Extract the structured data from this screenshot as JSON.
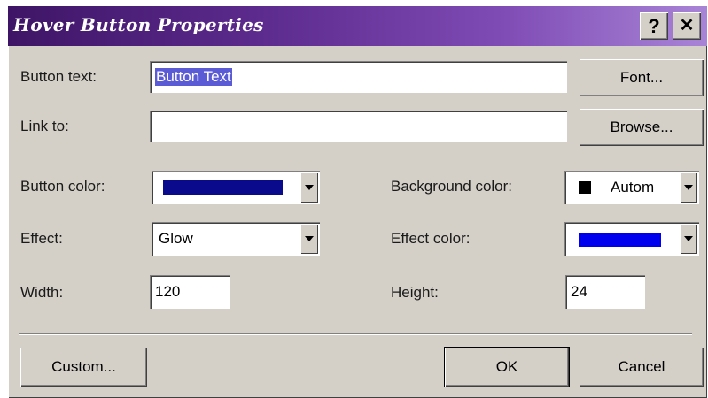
{
  "window": {
    "title": "Hover Button Properties",
    "help_label": "?",
    "close_label": "✕"
  },
  "fields": {
    "button_text": {
      "label": "Button text:",
      "value": "Button Text"
    },
    "link_to": {
      "label": "Link to:",
      "value": ""
    },
    "button_color": {
      "label": "Button color:",
      "color": "#0a0a8c"
    },
    "effect": {
      "label": "Effect:",
      "value": "Glow"
    },
    "width": {
      "label": "Width:",
      "value": "120"
    },
    "background_color": {
      "label": "Background color:",
      "value": "Autom",
      "color": "#000000"
    },
    "effect_color": {
      "label": "Effect color:",
      "color": "#0000ee"
    },
    "height": {
      "label": "Height:",
      "value": "24"
    }
  },
  "buttons": {
    "font": "Font...",
    "browse": "Browse...",
    "custom": "Custom...",
    "ok": "OK",
    "cancel": "Cancel"
  },
  "colors": {
    "dialog_bg": "#d4d0c8",
    "titlebar_start": "#3e1566",
    "titlebar_end": "#a884d6",
    "selection": "#5b5bd6"
  }
}
